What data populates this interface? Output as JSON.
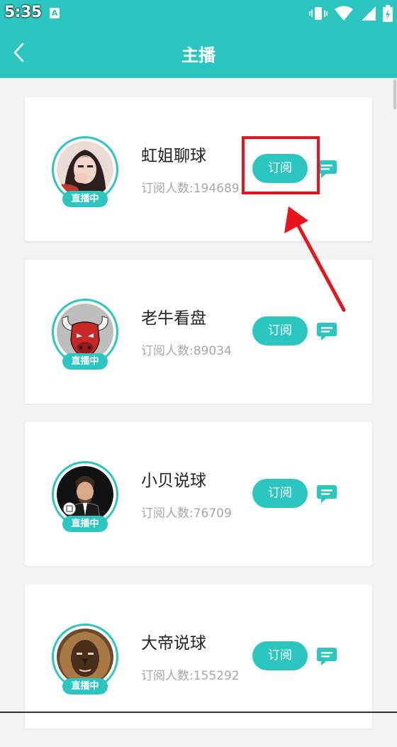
{
  "status_bar": {
    "time": "5:35",
    "app_icon": "A"
  },
  "header": {
    "title": "主播"
  },
  "anchors": [
    {
      "name": "虹姐聊球",
      "subscribers": "订阅人数:194689",
      "live_label": "直播中",
      "subscribe_label": "订阅",
      "avatar": "woman-portrait"
    },
    {
      "name": "老牛看盘",
      "subscribers": "订阅人数:89034",
      "live_label": "直播中",
      "subscribe_label": "订阅",
      "avatar": "bull-head"
    },
    {
      "name": "小贝说球",
      "subscribers": "订阅人数:76709",
      "live_label": "直播中",
      "subscribe_label": "订阅",
      "avatar": "caricature"
    },
    {
      "name": "大帝说球",
      "subscribers": "订阅人数:155292",
      "live_label": "直播中",
      "subscribe_label": "订阅",
      "avatar": "lion-face"
    }
  ],
  "colors": {
    "accent": "#2cc6c0",
    "highlight": "#e8141b"
  }
}
